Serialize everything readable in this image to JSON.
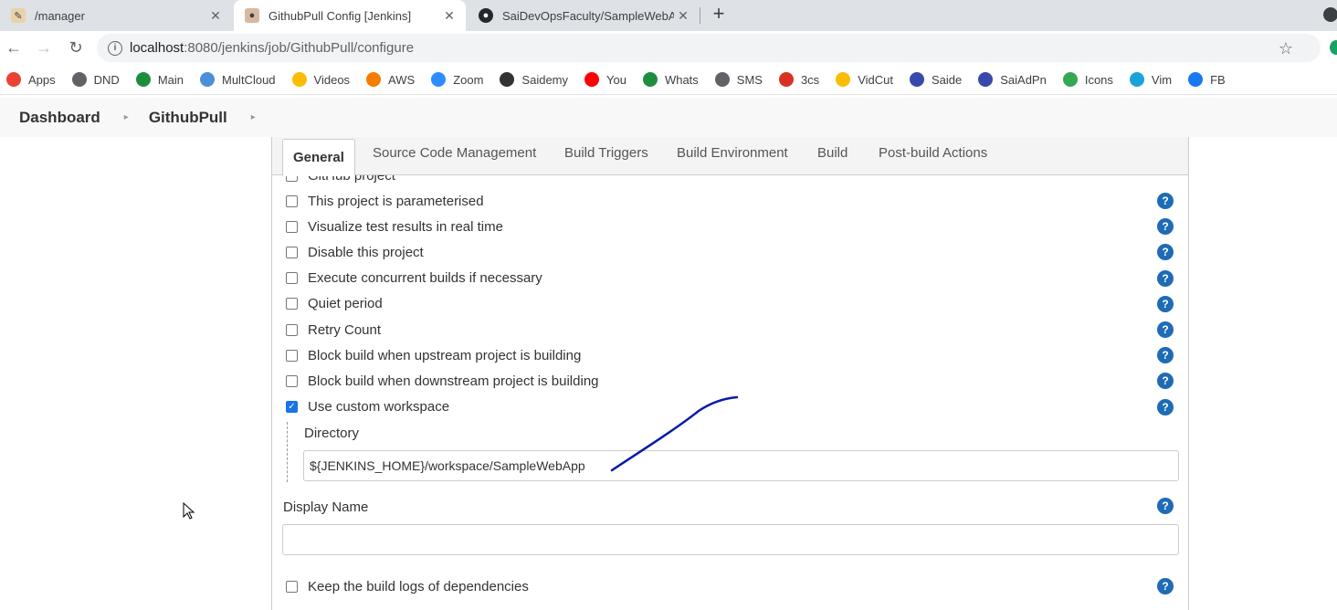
{
  "browser": {
    "tabs": [
      {
        "title": "/manager"
      },
      {
        "title": "GithubPull Config [Jenkins]"
      },
      {
        "title": "SaiDevOpsFaculty/SampleWebAp"
      }
    ],
    "url_host": "localhost",
    "url_rest": ":8080/jenkins/job/GithubPull/configure"
  },
  "bookmarks": [
    {
      "label": "Apps",
      "color": "#ea4335"
    },
    {
      "label": "DND",
      "color": "#5f6368"
    },
    {
      "label": "Main",
      "color": "#1e8e3e"
    },
    {
      "label": "MultCloud",
      "color": "#4a90d9"
    },
    {
      "label": "Videos",
      "color": "#fbbc04"
    },
    {
      "label": "AWS",
      "color": "#f57c00"
    },
    {
      "label": "Zoom",
      "color": "#2d8cff"
    },
    {
      "label": "Saidemy",
      "color": "#333333"
    },
    {
      "label": "You",
      "color": "#ff0000"
    },
    {
      "label": "Whats",
      "color": "#1e8e3e"
    },
    {
      "label": "SMS",
      "color": "#5f6368"
    },
    {
      "label": "3cs",
      "color": "#d93025"
    },
    {
      "label": "VidCut",
      "color": "#fbbc04"
    },
    {
      "label": "Saide",
      "color": "#3949ab"
    },
    {
      "label": "SaiAdPn",
      "color": "#3949ab"
    },
    {
      "label": "Icons",
      "color": "#34a853"
    },
    {
      "label": "Vim",
      "color": "#1aa3d8"
    },
    {
      "label": "FB",
      "color": "#1877f2"
    }
  ],
  "breadcrumb": {
    "items": [
      "Dashboard",
      "GithubPull"
    ]
  },
  "config": {
    "tabs": [
      "General",
      "Source Code Management",
      "Build Triggers",
      "Build Environment",
      "Build",
      "Post-build Actions"
    ],
    "partial_option": "GitHub project",
    "options": [
      {
        "label": "This project is parameterised",
        "checked": false
      },
      {
        "label": "Visualize test results in real time",
        "checked": false
      },
      {
        "label": "Disable this project",
        "checked": false
      },
      {
        "label": "Execute concurrent builds if necessary",
        "checked": false
      },
      {
        "label": "Quiet period",
        "checked": false
      },
      {
        "label": "Retry Count",
        "checked": false
      },
      {
        "label": "Block build when upstream project is building",
        "checked": false
      },
      {
        "label": "Block build when downstream project is building",
        "checked": false
      },
      {
        "label": "Use custom workspace",
        "checked": true
      }
    ],
    "directory_label": "Directory",
    "directory_value": "${JENKINS_HOME}/workspace/SampleWebApp",
    "display_name_label": "Display Name",
    "display_name_value": "",
    "keep_logs_label": "Keep the build logs of dependencies",
    "help_glyph": "?"
  },
  "colors": {
    "help_icon": "#1f6bb5",
    "checkbox_checked": "#1a73e8",
    "annotation_stroke": "#0a1aa8"
  }
}
